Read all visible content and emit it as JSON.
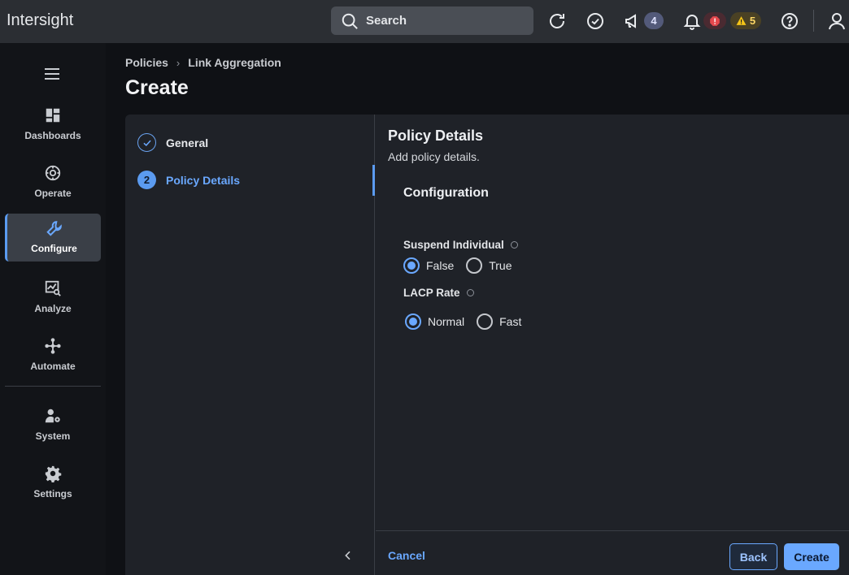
{
  "app": {
    "title": "Intersight"
  },
  "topbar": {
    "search_placeholder": "Search",
    "announcements_count": "4",
    "warnings_count": "5",
    "icons": [
      "search-icon",
      "refresh-icon",
      "check-circle-icon",
      "megaphone-icon",
      "bell-icon",
      "critical-alert-icon",
      "warning-icon",
      "help-icon",
      "user-icon"
    ]
  },
  "sidebar": {
    "items": [
      {
        "label": "Dashboards",
        "icon": "dashboards-icon"
      },
      {
        "label": "Operate",
        "icon": "operate-icon"
      },
      {
        "label": "Configure",
        "icon": "wrench-icon",
        "active": true
      },
      {
        "label": "Analyze",
        "icon": "analyze-icon"
      },
      {
        "label": "Automate",
        "icon": "automate-icon"
      },
      {
        "label": "System",
        "icon": "system-icon"
      },
      {
        "label": "Settings",
        "icon": "gear-icon"
      }
    ]
  },
  "breadcrumb": {
    "parent": "Policies",
    "current": "Link Aggregation"
  },
  "page": {
    "title": "Create"
  },
  "wizard": {
    "steps": [
      {
        "label": "General",
        "state": "done"
      },
      {
        "number": "2",
        "label": "Policy Details",
        "state": "current"
      }
    ]
  },
  "content": {
    "title": "Policy Details",
    "subtitle": "Add policy details.",
    "config_title": "Configuration",
    "suspend": {
      "label": "Suspend Individual",
      "options": [
        "False",
        "True"
      ],
      "selected": "False"
    },
    "lacp": {
      "label": "LACP Rate",
      "options": [
        "Normal",
        "Fast"
      ],
      "selected": "Normal"
    }
  },
  "footer": {
    "cancel": "Cancel",
    "back": "Back",
    "create": "Create"
  },
  "colors": {
    "accent": "#6aa8ff",
    "background": "#0f1115",
    "panel": "#1f2228",
    "topbar": "#2b2e33"
  }
}
